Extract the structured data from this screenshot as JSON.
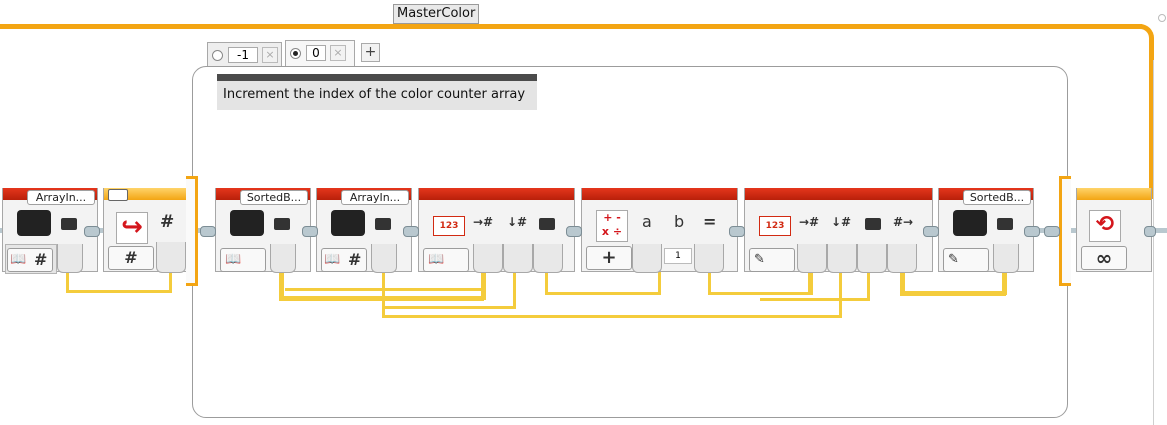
{
  "loop": {
    "name": "MasterColor",
    "count_mode_icon": "infinity-icon"
  },
  "switch": {
    "cases": [
      {
        "value": "-1",
        "selected": false
      },
      {
        "value": "0",
        "selected": true
      }
    ],
    "add_case_icon": "plus-icon"
  },
  "comment": {
    "text": "Increment the index of the color counter array"
  },
  "blocks": {
    "var_arrayin_1": {
      "name": "ArrayIn..."
    },
    "var_sortedb_1": {
      "name": "SortedB..."
    },
    "var_arrayin_2": {
      "name": "ArrayIn..."
    },
    "var_sortedb_2": {
      "name": "SortedB..."
    },
    "switch_hash": "#",
    "math_a": "a",
    "math_b": "b",
    "math_eq": "=",
    "math_b_value": "1",
    "array_icon_text": "123",
    "infinity": "∞",
    "hash": "#"
  },
  "colors": {
    "wire": "#f4cc3c",
    "loop_orange": "#f3a513",
    "block_red": "#d22a12"
  }
}
